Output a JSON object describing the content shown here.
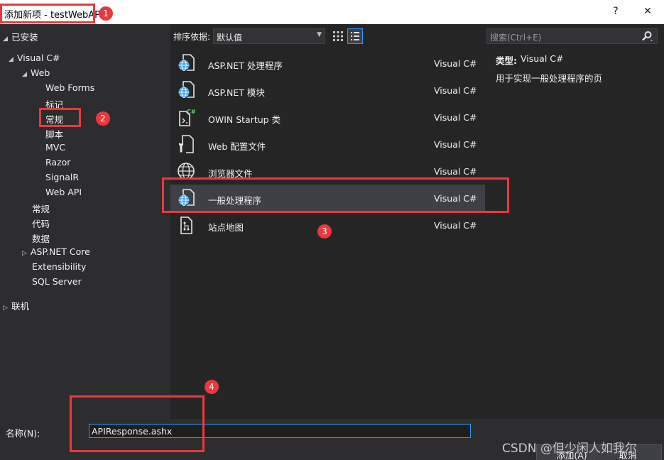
{
  "window": {
    "title": "添加新项 - testWebAP",
    "help_btn": "?",
    "close_btn": "✕"
  },
  "tree": {
    "installed": "已安装",
    "visual_csharp": "Visual C#",
    "web": "Web",
    "web_children": [
      "Web Forms",
      "标记",
      "常规",
      "脚本",
      "MVC",
      "Razor",
      "SignalR",
      "Web API"
    ],
    "csharp_children": [
      "常规",
      "代码",
      "数据",
      "ASP.NET Core",
      "Extensibility",
      "SQL Server"
    ],
    "online": "联机",
    "selected": "常规"
  },
  "toolbar": {
    "sort_label": "排序依据:",
    "sort_value": "默认值",
    "search_placeholder": "搜索(Ctrl+E)"
  },
  "templates": [
    {
      "name": "ASP.NET 处理程序",
      "lang": "Visual C#",
      "icon": "globe-page-icon"
    },
    {
      "name": "ASP.NET 模块",
      "lang": "Visual C#",
      "icon": "globe-page-icon"
    },
    {
      "name": "OWIN Startup 类",
      "lang": "Visual C#",
      "icon": "csharp-class-icon"
    },
    {
      "name": "Web 配置文件",
      "lang": "Visual C#",
      "icon": "wrench-config-icon"
    },
    {
      "name": "浏览器文件",
      "lang": "Visual C#",
      "icon": "globe-icon"
    },
    {
      "name": "一般处理程序",
      "lang": "Visual C#",
      "icon": "globe-page-icon",
      "selected": true
    },
    {
      "name": "站点地图",
      "lang": "Visual C#",
      "icon": "sitemap-icon"
    }
  ],
  "details": {
    "type_label": "类型:",
    "type_value": "Visual C#",
    "description": "用于实现一般处理程序的页"
  },
  "footer": {
    "name_label": "名称(N):",
    "name_value": "APIResponse.ashx",
    "add_button": "添加(A)",
    "cancel_button": "取消"
  },
  "watermark": "CSDN @但少闲人如我尔",
  "annotations": [
    "1",
    "2",
    "3",
    "4"
  ],
  "colors": {
    "accent": "#3399ff",
    "annotation": "#e8393e",
    "globe": "#3ba1e0"
  }
}
